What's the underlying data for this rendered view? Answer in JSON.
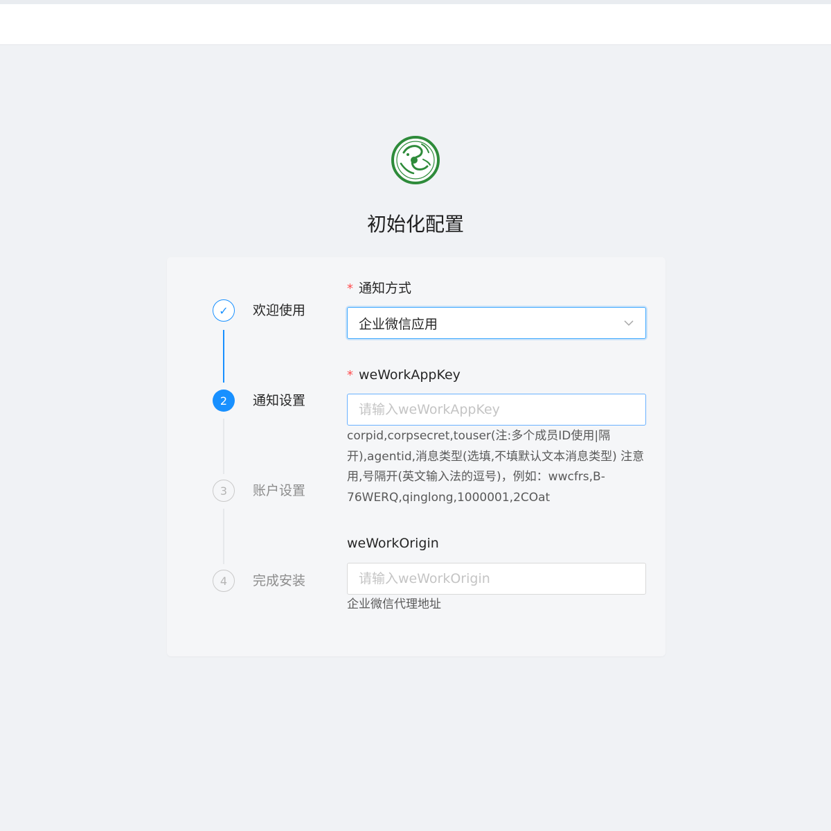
{
  "page": {
    "title": "初始化配置"
  },
  "steps": [
    {
      "label": "欢迎使用",
      "status": "finish",
      "marker": "✓"
    },
    {
      "label": "通知设置",
      "status": "process",
      "marker": "2"
    },
    {
      "label": "账户设置",
      "status": "wait",
      "marker": "3"
    },
    {
      "label": "完成安装",
      "status": "wait",
      "marker": "4"
    }
  ],
  "form": {
    "notify_method": {
      "label": "通知方式",
      "required_mark": "*",
      "value": "企业微信应用",
      "icon": "chevron-down-icon"
    },
    "app_key": {
      "label": "weWorkAppKey",
      "required_mark": "*",
      "value": "",
      "placeholder": "请输入weWorkAppKey",
      "help": "corpid,corpsecret,touser(注:多个成员ID使用|隔开),agentid,消息类型(选填,不填默认文本消息类型) 注意用,号隔开(英文输入法的逗号)，例如：wwcfrs,B-76WERQ,qinglong,1000001,2COat"
    },
    "origin": {
      "label": "weWorkOrigin",
      "value": "",
      "placeholder": "请输入weWorkOrigin",
      "help": "企业微信代理地址"
    }
  },
  "colors": {
    "primary": "#1890ff",
    "required": "#ff4d4f",
    "logo_green": "#2e8b3a",
    "background": "#f0f2f5"
  }
}
